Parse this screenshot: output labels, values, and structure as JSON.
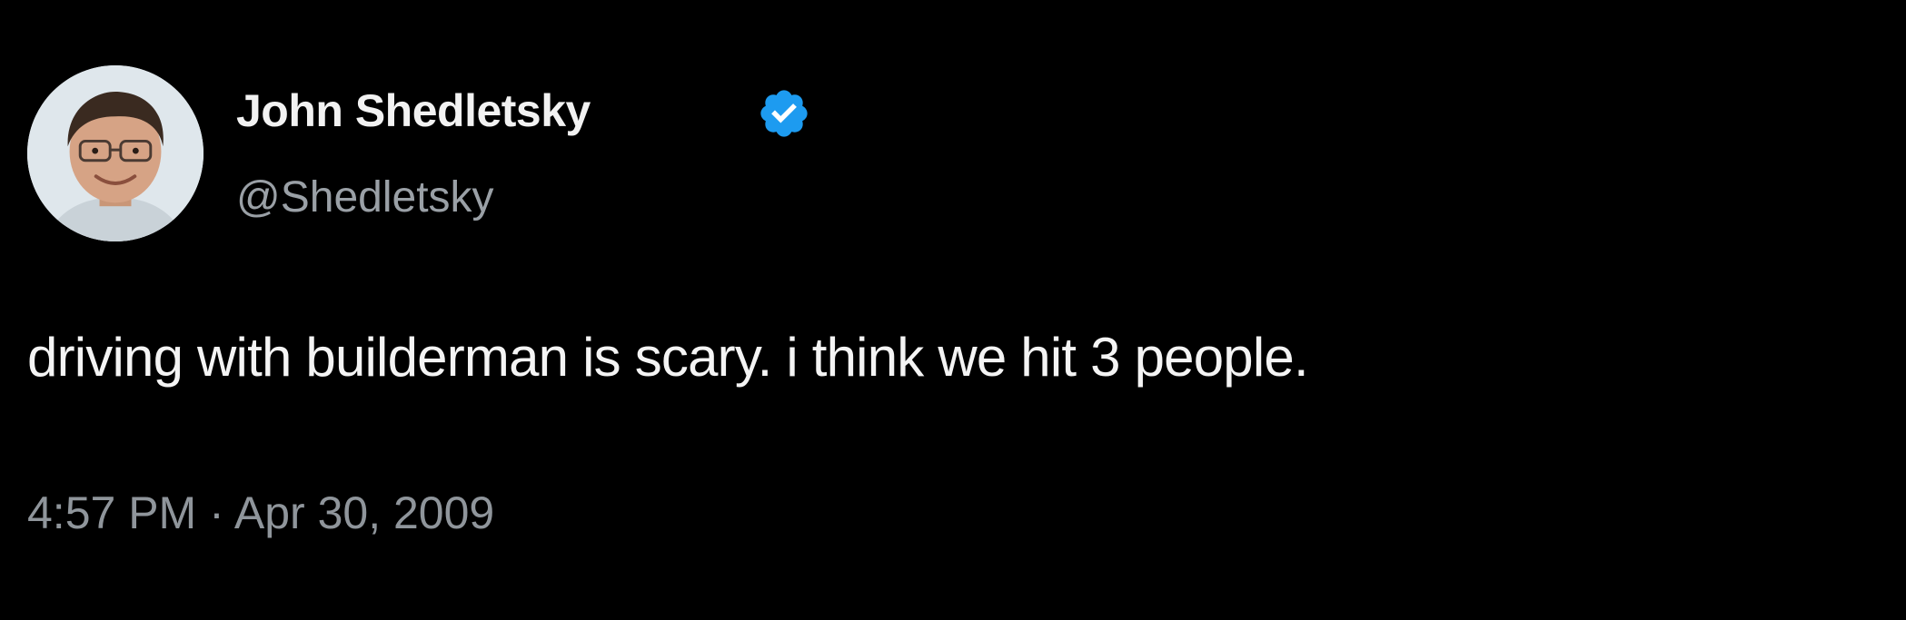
{
  "tweet": {
    "author": {
      "name": "John Shedletsky",
      "handle": "@Shedletsky",
      "verified": true,
      "avatar_icon": "profile-photo"
    },
    "text": "driving with builderman is scary. i think we hit 3 people.",
    "timestamp": "4:57 PM · Apr 30, 2009"
  },
  "colors": {
    "background": "#000000",
    "name_text": "#f2f2f2",
    "handle_text": "#9aa0a6",
    "body_text": "#f4f4f4",
    "timestamp_text": "#8f959b",
    "verified_badge": "#1d9bf0"
  }
}
